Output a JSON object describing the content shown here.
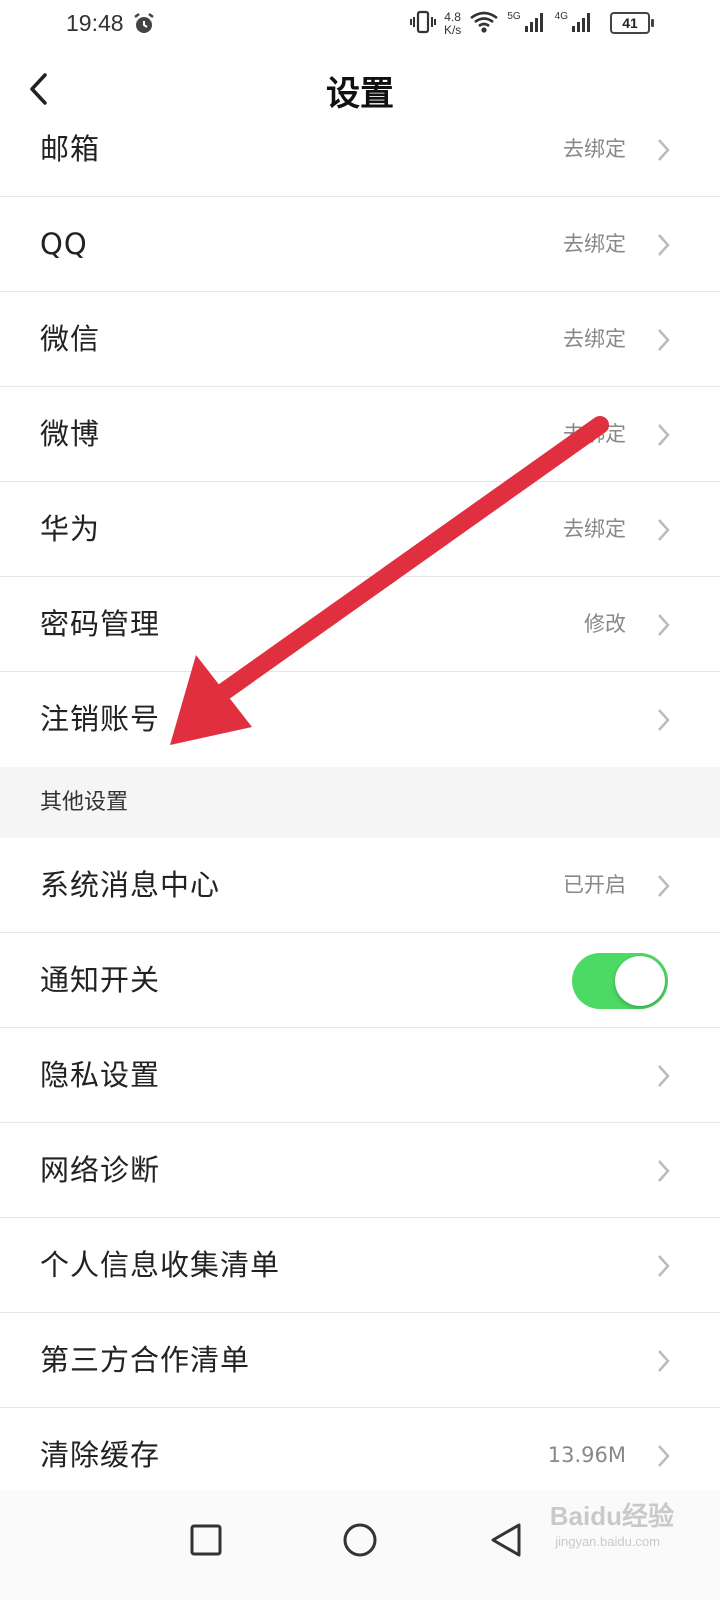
{
  "status_bar": {
    "time": "19:48",
    "net_speed_value": "4.8",
    "net_speed_unit": "K/s",
    "signal_1_label": "5G",
    "signal_2_label": "4G",
    "battery": "41",
    "icons": [
      "alarm-icon",
      "vibrate-icon",
      "wifi-icon",
      "signal-icon",
      "battery-icon"
    ]
  },
  "header": {
    "title": "设置",
    "back_icon": "chevron-left-icon"
  },
  "account_rows": [
    {
      "label": "邮箱",
      "value": "去绑定"
    },
    {
      "label": "QQ",
      "value": "去绑定"
    },
    {
      "label": "微信",
      "value": "去绑定"
    },
    {
      "label": "微博",
      "value": "去绑定"
    },
    {
      "label": "华为",
      "value": "去绑定"
    },
    {
      "label": "密码管理",
      "value": "修改"
    },
    {
      "label": "注销账号",
      "value": ""
    }
  ],
  "other_section": {
    "title": "其他设置",
    "rows": [
      {
        "label": "系统消息中心",
        "value": "已开启"
      },
      {
        "label": "通知开关",
        "toggle_on": true
      },
      {
        "label": "隐私设置",
        "value": ""
      },
      {
        "label": "网络诊断",
        "value": ""
      },
      {
        "label": "个人信息收集清单",
        "value": ""
      },
      {
        "label": "第三方合作清单",
        "value": ""
      },
      {
        "label": "清除缓存",
        "value": "13.96M"
      }
    ]
  },
  "colors": {
    "toggle_on": "#4cd964",
    "annotation_arrow": "#e03040",
    "section_bg": "#f5f5f5"
  },
  "watermark": {
    "brand": "Baidu经验",
    "sub": "jingyan.baidu.com"
  }
}
